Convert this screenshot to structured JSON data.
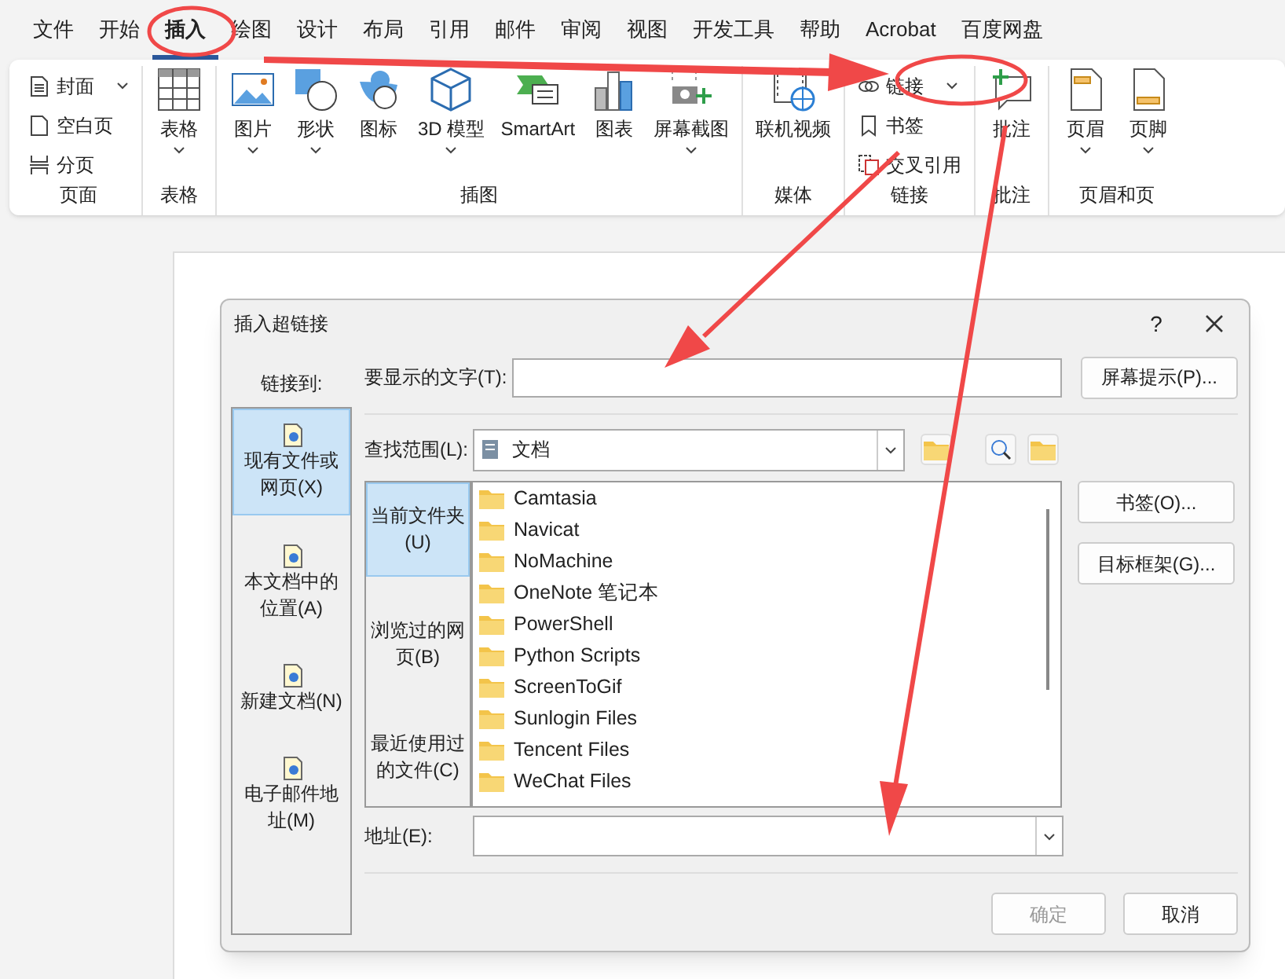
{
  "menu_tabs": [
    {
      "label": "文件",
      "selected": false
    },
    {
      "label": "开始",
      "selected": false
    },
    {
      "label": "插入",
      "selected": true
    },
    {
      "label": "绘图",
      "selected": false
    },
    {
      "label": "设计",
      "selected": false
    },
    {
      "label": "布局",
      "selected": false
    },
    {
      "label": "引用",
      "selected": false
    },
    {
      "label": "邮件",
      "selected": false
    },
    {
      "label": "审阅",
      "selected": false
    },
    {
      "label": "视图",
      "selected": false
    },
    {
      "label": "开发工具",
      "selected": false
    },
    {
      "label": "帮助",
      "selected": false
    },
    {
      "label": "Acrobat",
      "selected": false
    },
    {
      "label": "百度网盘",
      "selected": false
    }
  ],
  "ribbon_groups": [
    {
      "label": "页面",
      "items": [
        {
          "kind": "small",
          "label": "封面",
          "dropdown": true
        },
        {
          "kind": "small",
          "label": "空白页",
          "dropdown": false
        },
        {
          "kind": "small",
          "label": "分页",
          "dropdown": false
        }
      ]
    },
    {
      "label": "表格",
      "items": [
        {
          "kind": "large",
          "label": "表格",
          "dropdown": true
        }
      ]
    },
    {
      "label": "插图",
      "items": [
        {
          "kind": "large",
          "label": "图片",
          "dropdown": true
        },
        {
          "kind": "large",
          "label": "形状",
          "dropdown": true
        },
        {
          "kind": "large",
          "label": "图标",
          "dropdown": false
        },
        {
          "kind": "large",
          "label": "3D 模型",
          "dropdown": true
        },
        {
          "kind": "large",
          "label": "SmartArt",
          "dropdown": false
        },
        {
          "kind": "large",
          "label": "图表",
          "dropdown": false
        },
        {
          "kind": "large",
          "label": "屏幕截图",
          "dropdown": true
        }
      ]
    },
    {
      "label": "媒体",
      "items": [
        {
          "kind": "large",
          "label": "联机视频",
          "dropdown": false
        }
      ]
    },
    {
      "label": "链接",
      "items": [
        {
          "kind": "small",
          "label": "链接",
          "dropdown": true
        },
        {
          "kind": "small",
          "label": "书签",
          "dropdown": false
        },
        {
          "kind": "small",
          "label": "交叉引用",
          "dropdown": false
        }
      ]
    },
    {
      "label": "批注",
      "items": [
        {
          "kind": "large",
          "label": "批注",
          "dropdown": false
        }
      ]
    },
    {
      "label": "页眉和页",
      "items": [
        {
          "kind": "large",
          "label": "页眉",
          "dropdown": true
        },
        {
          "kind": "large",
          "label": "页脚",
          "dropdown": true
        }
      ]
    }
  ],
  "dialog": {
    "title": "插入超链接",
    "help": "?",
    "link_to_label": "链接到:",
    "places": [
      {
        "label": "现有文件或网页(X)",
        "selected": true
      },
      {
        "label": "本文档中的位置(A)",
        "selected": false
      },
      {
        "label": "新建文档(N)",
        "selected": false
      },
      {
        "label": "电子邮件地址(M)",
        "selected": false
      }
    ],
    "display_text": {
      "label": "要显示的文字(T):"
    },
    "screentip_button": "屏幕提示(P)...",
    "look_in": {
      "label": "查找范围(L):",
      "value": "文档"
    },
    "nav": [
      {
        "label": "当前文件夹(U)",
        "selected": true
      },
      {
        "label": "浏览过的网页(B)",
        "selected": false
      },
      {
        "label": "最近使用过的文件(C)",
        "selected": false
      }
    ],
    "files": [
      "Camtasia",
      "Navicat",
      "NoMachine",
      "OneNote 笔记本",
      "PowerShell",
      "Python Scripts",
      "ScreenToGif",
      "Sunlogin Files",
      "Tencent Files",
      "WeChat Files"
    ],
    "side_buttons": [
      "书签(O)...",
      "目标框架(G)..."
    ],
    "address": {
      "label": "地址(E):"
    },
    "ok": {
      "label": "确定",
      "disabled": true
    },
    "cancel": {
      "label": "取消",
      "disabled": false
    }
  }
}
